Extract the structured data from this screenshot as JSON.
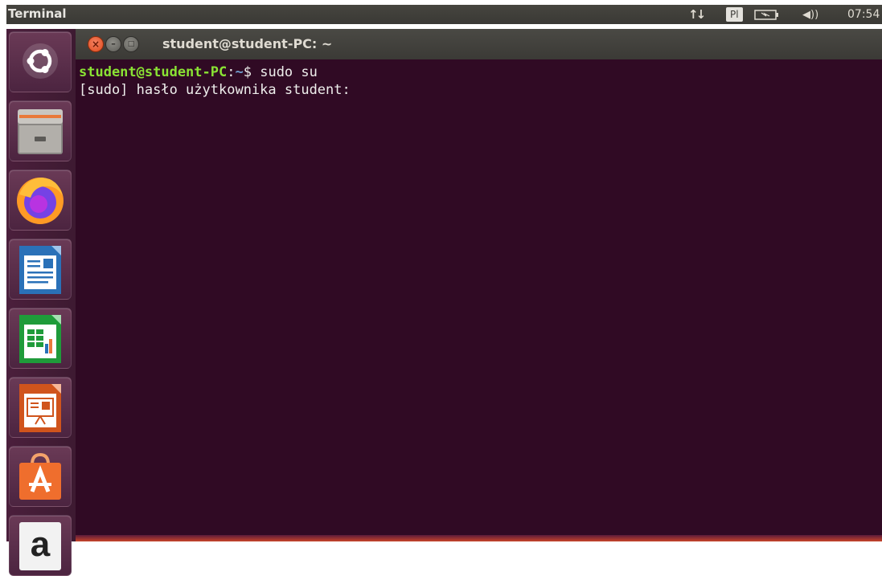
{
  "top_panel": {
    "app_title": "Terminal",
    "keyboard_layout": "Pl",
    "clock": "07:54",
    "icons": [
      "network-icon",
      "battery-icon",
      "volume-icon"
    ]
  },
  "launcher": {
    "items": [
      {
        "name": "ubuntu-dash-icon"
      },
      {
        "name": "files-icon"
      },
      {
        "name": "firefox-icon"
      },
      {
        "name": "libreoffice-writer-icon"
      },
      {
        "name": "libreoffice-calc-icon"
      },
      {
        "name": "libreoffice-impress-icon"
      },
      {
        "name": "ubuntu-software-icon"
      },
      {
        "name": "amazon-icon",
        "glyph": "a"
      }
    ]
  },
  "window": {
    "title": "student@student-PC: ~",
    "close_glyph": "×",
    "minimize_glyph": "–",
    "maximize_glyph": "□"
  },
  "terminal": {
    "lines": [
      {
        "user_host": "student@student-PC",
        "sep": ":",
        "path": "~",
        "symbol": "$ ",
        "command": "sudo su"
      },
      {
        "text": "[sudo] hasło użytkownika student:"
      }
    ]
  },
  "colors": {
    "terminal_bg": "#300a24",
    "prompt_user": "#8ae234",
    "prompt_path": "#729fcf",
    "close_button": "#df4a1b",
    "launcher_bg": "#411c32"
  }
}
